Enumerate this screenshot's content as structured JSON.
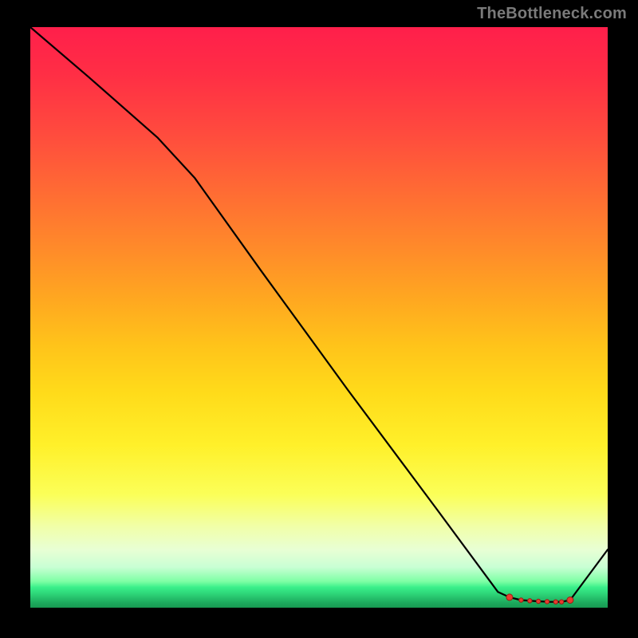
{
  "watermark": "TheBottleneck.com",
  "colors": {
    "page_bg": "#000000",
    "gradient_top": "#ff1f4b",
    "gradient_bottom": "#189851",
    "curve_stroke": "#000000",
    "dot_fill": "#ea3b2e"
  },
  "chart_data": {
    "type": "line",
    "title": "",
    "xlabel": "",
    "ylabel": "",
    "xlim": [
      0,
      100
    ],
    "ylim": [
      0,
      100
    ],
    "grid": false,
    "legend": false,
    "notes": "No axes, ticks, or units are visible. Values below are positions in percent of the plot area, read from pixel geometry; y is inverted so 0 = bottom, 100 = top.",
    "series": [
      {
        "name": "curve",
        "x": [
          0,
          10,
          22,
          28.5,
          40,
          55,
          70,
          81,
          83,
          85,
          88,
          90,
          92,
          93.5,
          100
        ],
        "y": [
          100,
          91.5,
          81,
          74,
          58,
          37.5,
          17.5,
          2.7,
          1.8,
          1.3,
          1.1,
          1.0,
          1.0,
          1.3,
          10
        ]
      }
    ],
    "highlight_points": {
      "name": "flat-valley-dots",
      "x": [
        83,
        85,
        86.5,
        88,
        89.5,
        91,
        92,
        93.5
      ],
      "y": [
        1.8,
        1.3,
        1.2,
        1.1,
        1.05,
        1.0,
        1.0,
        1.3
      ]
    }
  }
}
